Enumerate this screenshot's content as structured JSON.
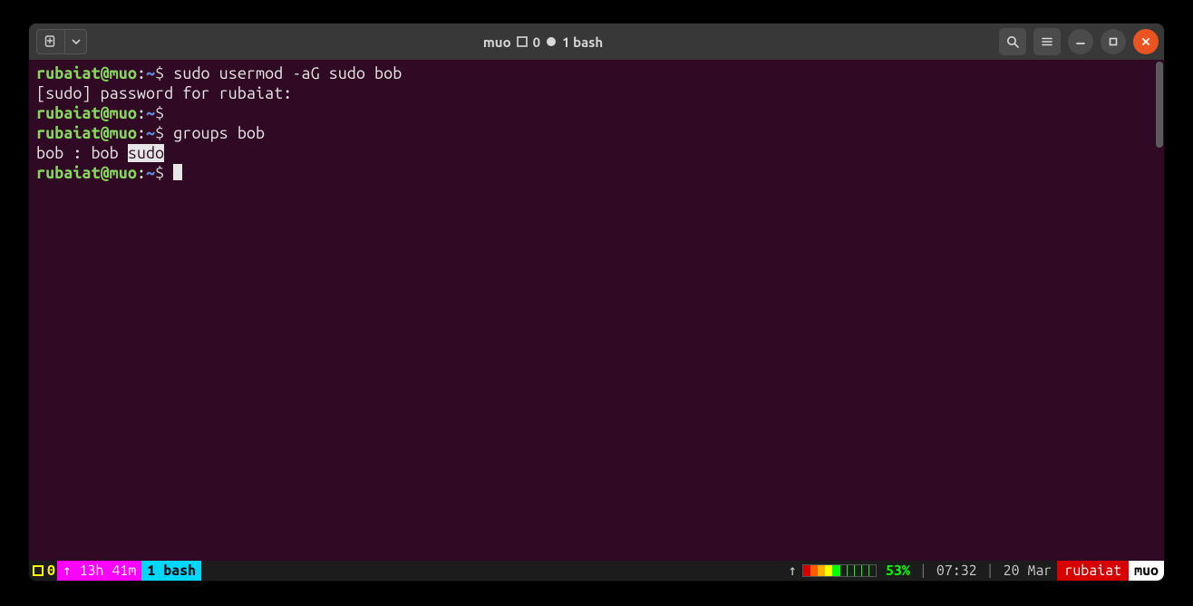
{
  "titlebar": {
    "title_prefix": "muo",
    "win_index": "0",
    "title_suffix": "1 bash"
  },
  "session": {
    "lines": [
      {
        "user": "rubaiat",
        "host": "muo",
        "path": "~",
        "sep": "$",
        "command": "sudo usermod -aG sudo bob"
      },
      {
        "text": "[sudo] password for rubaiat:"
      },
      {
        "user": "rubaiat",
        "host": "muo",
        "path": "~",
        "sep": "$",
        "command": ""
      },
      {
        "user": "rubaiat",
        "host": "muo",
        "path": "~",
        "sep": "$",
        "command": "groups bob"
      },
      {
        "before": "bob : bob ",
        "highlight": "sudo"
      },
      {
        "user": "rubaiat",
        "host": "muo",
        "path": "~",
        "sep": "$",
        "command": ""
      }
    ]
  },
  "status": {
    "session": "0",
    "uptime": "13h 41m",
    "window": "1 bash",
    "battery_pct": "53%",
    "time": "07:32",
    "date": "20 Mar",
    "user": "rubaiat",
    "host": "muo"
  }
}
